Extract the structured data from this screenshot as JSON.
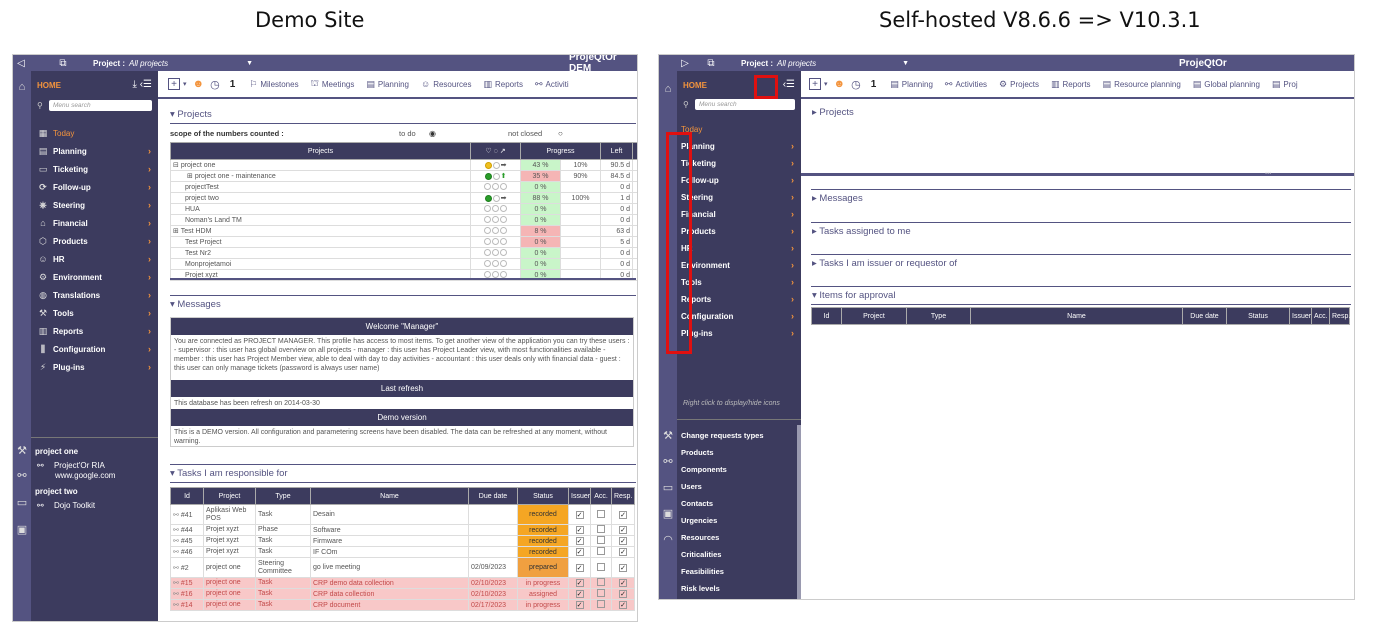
{
  "captions": {
    "left": "Demo Site",
    "right": "Self-hosted V8.6.6 => V10.3.1"
  },
  "left": {
    "topbar": {
      "project_label": "Project :",
      "project_value": "All projects",
      "app_name": "ProjeQtOr DEM"
    },
    "sidebar": {
      "home": "HOME",
      "search_placeholder": "Menu search",
      "items": [
        {
          "label": "Today",
          "icon": "calendar-icon"
        },
        {
          "label": "Planning",
          "icon": "planning-icon"
        },
        {
          "label": "Ticketing",
          "icon": "ticket-icon"
        },
        {
          "label": "Follow-up",
          "icon": "followup-icon"
        },
        {
          "label": "Steering",
          "icon": "steering-icon"
        },
        {
          "label": "Financial",
          "icon": "bank-icon"
        },
        {
          "label": "Products",
          "icon": "box-icon"
        },
        {
          "label": "HR",
          "icon": "people-icon"
        },
        {
          "label": "Environment",
          "icon": "gear-icon"
        },
        {
          "label": "Translations",
          "icon": "globe-icon"
        },
        {
          "label": "Tools",
          "icon": "wrench-icon"
        },
        {
          "label": "Reports",
          "icon": "report-icon"
        },
        {
          "label": "Configuration",
          "icon": "config-icon"
        },
        {
          "label": "Plug-ins",
          "icon": "plugin-icon"
        }
      ],
      "tree": {
        "project_one": "project one",
        "ria": "Project'Or RIA",
        "google": "www.google.com",
        "project_two": "project two",
        "dojo": "Dojo Toolkit"
      }
    },
    "toolbar": {
      "number": "1",
      "buttons": [
        "Milestones",
        "Meetings",
        "Planning",
        "Resources",
        "Reports",
        "Activiti"
      ]
    },
    "projects": {
      "title": "Projects",
      "scope_label": "scope of the numbers counted :",
      "todo_label": "to do",
      "notclosed_label": "not closed",
      "headers": [
        "Projects",
        "Progress",
        "Left"
      ],
      "rows": [
        {
          "name": "project one",
          "pct": "43 %",
          "c2": "10%",
          "left": "90.5 d",
          "color": "g"
        },
        {
          "name": "project one - maintenance",
          "pct": "35 %",
          "c2": "90%",
          "left": "84.5 d",
          "color": "r"
        },
        {
          "name": "projectTest",
          "pct": "0 %",
          "c2": "",
          "left": "0 d",
          "color": "g"
        },
        {
          "name": "project two",
          "pct": "88 %",
          "c2": "100%",
          "left": "1 d",
          "color": "g"
        },
        {
          "name": "HUA",
          "pct": "0 %",
          "c2": "",
          "left": "0 d",
          "color": "g"
        },
        {
          "name": "Noman's Land TM",
          "pct": "0 %",
          "c2": "",
          "left": "0 d",
          "color": "g"
        },
        {
          "name": "Test HDM",
          "pct": "8 %",
          "c2": "",
          "left": "63 d",
          "color": "r"
        },
        {
          "name": "Test Project",
          "pct": "0 %",
          "c2": "",
          "left": "5 d",
          "color": "r"
        },
        {
          "name": "Test Nr2",
          "pct": "0 %",
          "c2": "",
          "left": "0 d",
          "color": "g"
        },
        {
          "name": "Monprojetamoi",
          "pct": "0 %",
          "c2": "",
          "left": "0 d",
          "color": "g"
        },
        {
          "name": "Projet xyzt",
          "pct": "0 %",
          "c2": "",
          "left": "0 d",
          "color": "g"
        }
      ]
    },
    "messages": {
      "title": "Messages",
      "welcome_head": "Welcome \"Manager\"",
      "welcome_body": "You are connected as PROJECT MANAGER. This profile has access to most items. To get another view of the application you can try these users : - supervisor : this user has global overview on all projects - manager : this user has Project Leader view, with most functionalities available - member : this user has Project Member view, able to deal with day to day activities - accountant : this user deals only with financial data - guest : this user can only manage tickets (password is always user name)",
      "refresh_head": "Last refresh",
      "refresh_body": "This database has been refresh on 2014-03-30",
      "demo_head": "Demo version",
      "demo_body": "This is a DEMO version. All configuration and parametering screens have been disabled. The data can be refreshed at any moment, without warning."
    },
    "tasks": {
      "title": "Tasks I am responsible for",
      "headers": [
        "Id",
        "Project",
        "Type",
        "Name",
        "Due date",
        "Status",
        "Issuer",
        "Acc.",
        "Resp."
      ],
      "rows": [
        {
          "id": "#41",
          "project": "Aplikasi Web POS",
          "type": "Task",
          "name": "Desain",
          "due": "",
          "status": "recorded",
          "issuer": true,
          "acc": false,
          "resp": true,
          "pink": false
        },
        {
          "id": "#44",
          "project": "Projet xyzt",
          "type": "Phase",
          "name": "Software",
          "due": "",
          "status": "recorded",
          "issuer": true,
          "acc": false,
          "resp": true,
          "pink": false
        },
        {
          "id": "#45",
          "project": "Projet xyzt",
          "type": "Task",
          "name": "Firmware",
          "due": "",
          "status": "recorded",
          "issuer": true,
          "acc": false,
          "resp": true,
          "pink": false
        },
        {
          "id": "#46",
          "project": "Projet xyzt",
          "type": "Task",
          "name": "IF COm",
          "due": "",
          "status": "recorded",
          "issuer": true,
          "acc": false,
          "resp": true,
          "pink": false
        },
        {
          "id": "#2",
          "project": "project one",
          "type": "Steering Committee",
          "name": "go live meeting",
          "due": "02/09/2023",
          "status": "prepared",
          "issuer": true,
          "acc": false,
          "resp": true,
          "pink": false
        },
        {
          "id": "#15",
          "project": "project one",
          "type": "Task",
          "name": "CRP demo data collection",
          "due": "02/10/2023",
          "status": "in progress",
          "issuer": true,
          "acc": false,
          "resp": true,
          "pink": true
        },
        {
          "id": "#16",
          "project": "project one",
          "type": "Task",
          "name": "CRP data collection",
          "due": "02/10/2023",
          "status": "assigned",
          "issuer": true,
          "acc": false,
          "resp": true,
          "pink": true
        },
        {
          "id": "#14",
          "project": "project one",
          "type": "Task",
          "name": "CRP document",
          "due": "02/17/2023",
          "status": "in progress",
          "issuer": true,
          "acc": false,
          "resp": true,
          "pink": true
        }
      ]
    }
  },
  "right": {
    "topbar": {
      "project_label": "Project :",
      "project_value": "All projects",
      "app_name": "ProjeQtOr"
    },
    "sidebar": {
      "home": "HOME",
      "search_placeholder": "Menu search",
      "items": [
        "Today",
        "Planning",
        "Ticketing",
        "Follow-up",
        "Steering",
        "Financial",
        "Products",
        "HR",
        "Environment",
        "Tools",
        "Reports",
        "Configuration",
        "Plug-ins"
      ],
      "hint": "Right click to display/hide icons",
      "sub_items": [
        "Change requests types",
        "Products",
        "Components",
        "Users",
        "Contacts",
        "Urgencies",
        "Resources",
        "Criticalities",
        "Feasibilities",
        "Risk levels"
      ]
    },
    "toolbar": {
      "number": "1",
      "buttons": [
        "Planning",
        "Activities",
        "Projects",
        "Reports",
        "Resource planning",
        "Global planning",
        "Proj"
      ]
    },
    "sections": {
      "projects": "Projects",
      "messages": "Messages",
      "assigned": "Tasks assigned to me",
      "issuer": "Tasks I am issuer or requestor of",
      "approval": "Items for approval"
    },
    "approval_headers": [
      "Id",
      "Project",
      "Type",
      "Name",
      "Due date",
      "Status",
      "Issuer",
      "Acc.",
      "Resp."
    ],
    "highlight_color": "#e01010"
  }
}
